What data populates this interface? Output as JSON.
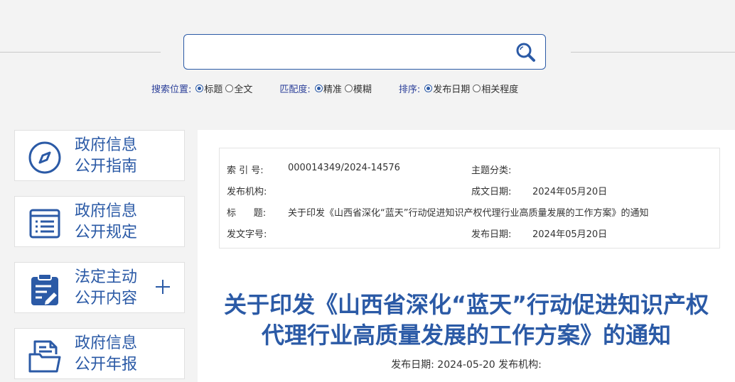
{
  "search": {
    "value": "",
    "placeholder": ""
  },
  "options": {
    "position": {
      "label": "搜索位置:",
      "items": [
        {
          "label": "标题",
          "checked": true
        },
        {
          "label": "全文",
          "checked": false
        }
      ]
    },
    "match": {
      "label": "匹配度:",
      "items": [
        {
          "label": "精准",
          "checked": true
        },
        {
          "label": "模糊",
          "checked": false
        }
      ]
    },
    "sort": {
      "label": "排序:",
      "items": [
        {
          "label": "发布日期",
          "checked": true
        },
        {
          "label": "相关程度",
          "checked": false
        }
      ]
    }
  },
  "sidebar": {
    "items": [
      {
        "line1": "政府信息",
        "line2": "公开指南",
        "icon": "compass-icon"
      },
      {
        "line1": "政府信息",
        "line2": "公开规定",
        "icon": "document-list-icon"
      },
      {
        "line1": "法定主动",
        "line2": "公开内容",
        "icon": "clipboard-edit-icon"
      },
      {
        "line1": "政府信息",
        "line2": "公开年报",
        "icon": "folder-report-icon"
      }
    ]
  },
  "info": {
    "index_label": "索 引 号:",
    "index_value": "000014349/2024-14576",
    "topic_label": "主题分类:",
    "topic_value": "",
    "org_label": "发布机构:",
    "org_value": "",
    "created_label": "成文日期:",
    "created_value": "2024年05月20日",
    "title_label": "标      题:",
    "title_value": "关于印发《山西省深化“蓝天”行动促进知识产权代理行业高质量发展的工作方案》的通知",
    "docno_label": "发文字号:",
    "docno_value": "",
    "pub_label": "发布日期:",
    "pub_value": "2024年05月20日"
  },
  "document": {
    "title_line1": "关于印发《山西省深化“蓝天”行动促进知识产权",
    "title_line2": "代理行业高质量发展的工作方案》的通知",
    "meta": "发布日期: 2024-05-20 发布机构:"
  },
  "colors": {
    "accent": "#2b5aa6",
    "label": "#2b3f99"
  }
}
